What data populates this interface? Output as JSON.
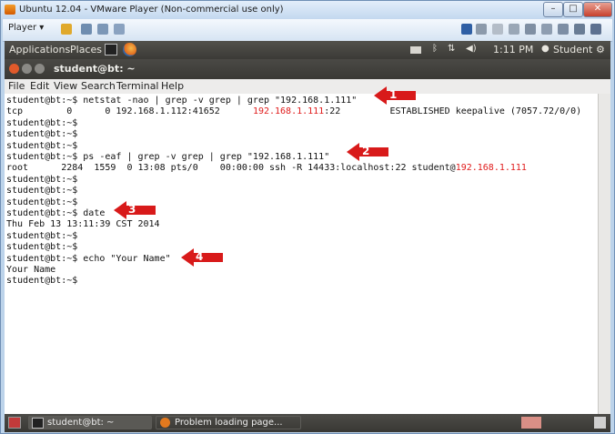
{
  "vmware": {
    "title": "Ubuntu 12.04 - VMware Player (Non-commercial use only)",
    "player_label": "Player ▾"
  },
  "panel": {
    "applications": "Applications",
    "places": "Places",
    "time": "1:11 PM",
    "user": "Student"
  },
  "terminal": {
    "title": "student@bt: ~",
    "menu": [
      "File",
      "Edit",
      "View",
      "Search",
      "Terminal",
      "Help"
    ],
    "lines": [
      {
        "t": "student@bt:~$ netstat -nao | grep -v grep | grep \"192.168.1.111\""
      },
      {
        "a": "tcp        0      0 192.168.1.112:41652      ",
        "r": "192.168.1.111",
        "b": ":22         ESTABLISHED keepalive (7057.72/0/0)"
      },
      {
        "t": "student@bt:~$"
      },
      {
        "t": "student@bt:~$"
      },
      {
        "t": "student@bt:~$"
      },
      {
        "t": "student@bt:~$ ps -eaf | grep -v grep | grep \"192.168.1.111\""
      },
      {
        "a": "root      2284  1559  0 13:08 pts/0    00:00:00 ssh -R 14433:localhost:22 student@",
        "r": "192.168.1.111",
        "b": ""
      },
      {
        "t": "student@bt:~$"
      },
      {
        "t": "student@bt:~$"
      },
      {
        "t": "student@bt:~$"
      },
      {
        "t": "student@bt:~$ date"
      },
      {
        "t": "Thu Feb 13 13:11:39 CST 2014"
      },
      {
        "t": "student@bt:~$"
      },
      {
        "t": "student@bt:~$"
      },
      {
        "t": "student@bt:~$ echo \"Your Name\""
      },
      {
        "t": "Your Name"
      },
      {
        "t": "student@bt:~$"
      }
    ]
  },
  "callouts": [
    "1",
    "2",
    "3",
    "4"
  ],
  "taskbar": {
    "terminal_task": "student@bt: ~",
    "browser_task": "Problem loading page..."
  },
  "colors": {
    "highlight": "#e01b1b",
    "callout": "#d81a1a"
  }
}
